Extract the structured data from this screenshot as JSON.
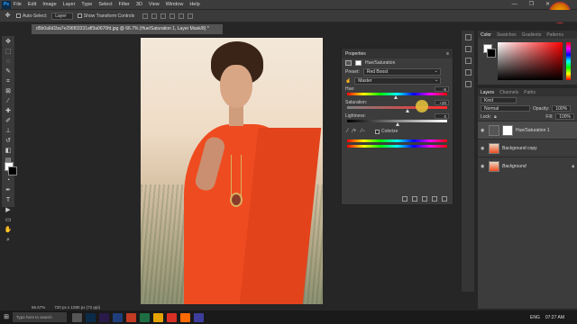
{
  "app": {
    "logo": "Ps"
  },
  "menu": [
    "File",
    "Edit",
    "Image",
    "Layer",
    "Type",
    "Select",
    "Filter",
    "3D",
    "View",
    "Window",
    "Help"
  ],
  "window_controls": [
    "—",
    "❐",
    "✕"
  ],
  "options_bar": {
    "auto_select_label": "Auto-Select:",
    "auto_select_value": "Layer",
    "show_transform_label": "Show Transform Controls"
  },
  "document_tab": "d5b0a6d1ba7e296f03331aff3a0670fd.jpg @ 66.7% (Hue/Saturation 1, Layer Mask/8) *",
  "properties": {
    "title": "Properties",
    "adjustment_name": "Hue/Saturation",
    "preset_label": "Preset:",
    "preset_value": "Red Boost",
    "channel_value": "Master",
    "hue_label": "Hue:",
    "hue_value": "-5",
    "hue_level": 0.49,
    "saturation_label": "Saturation:",
    "saturation_value": "+20",
    "saturation_level": 0.6,
    "lightness_label": "Lightness:",
    "lightness_value": "0",
    "lightness_level": 0.5,
    "colorize_label": "Colorize"
  },
  "color_panel": {
    "tabs": [
      "Color",
      "Swatches",
      "Gradients",
      "Patterns"
    ],
    "accent": "#ff0000"
  },
  "layers_panel": {
    "tabs": [
      "Layers",
      "Channels",
      "Paths"
    ],
    "filter_label": "Kind",
    "blend_mode": "Normal",
    "opacity_label": "Opacity:",
    "opacity_value": "100%",
    "lock_label": "Lock:",
    "fill_label": "Fill:",
    "fill_value": "100%",
    "layers": [
      {
        "name": "Hue/Saturation 1",
        "active": true,
        "italic": false
      },
      {
        "name": "Background copy",
        "active": false,
        "italic": false
      },
      {
        "name": "Background",
        "active": false,
        "italic": true
      }
    ]
  },
  "status_bar": {
    "zoom": "66.67%",
    "doc_size": "720 px x 1080 px (72 ppi)"
  },
  "taskbar": {
    "search_placeholder": "Type here to search",
    "language": "ENG",
    "time": "07:27 AM"
  },
  "watermark": "KK"
}
